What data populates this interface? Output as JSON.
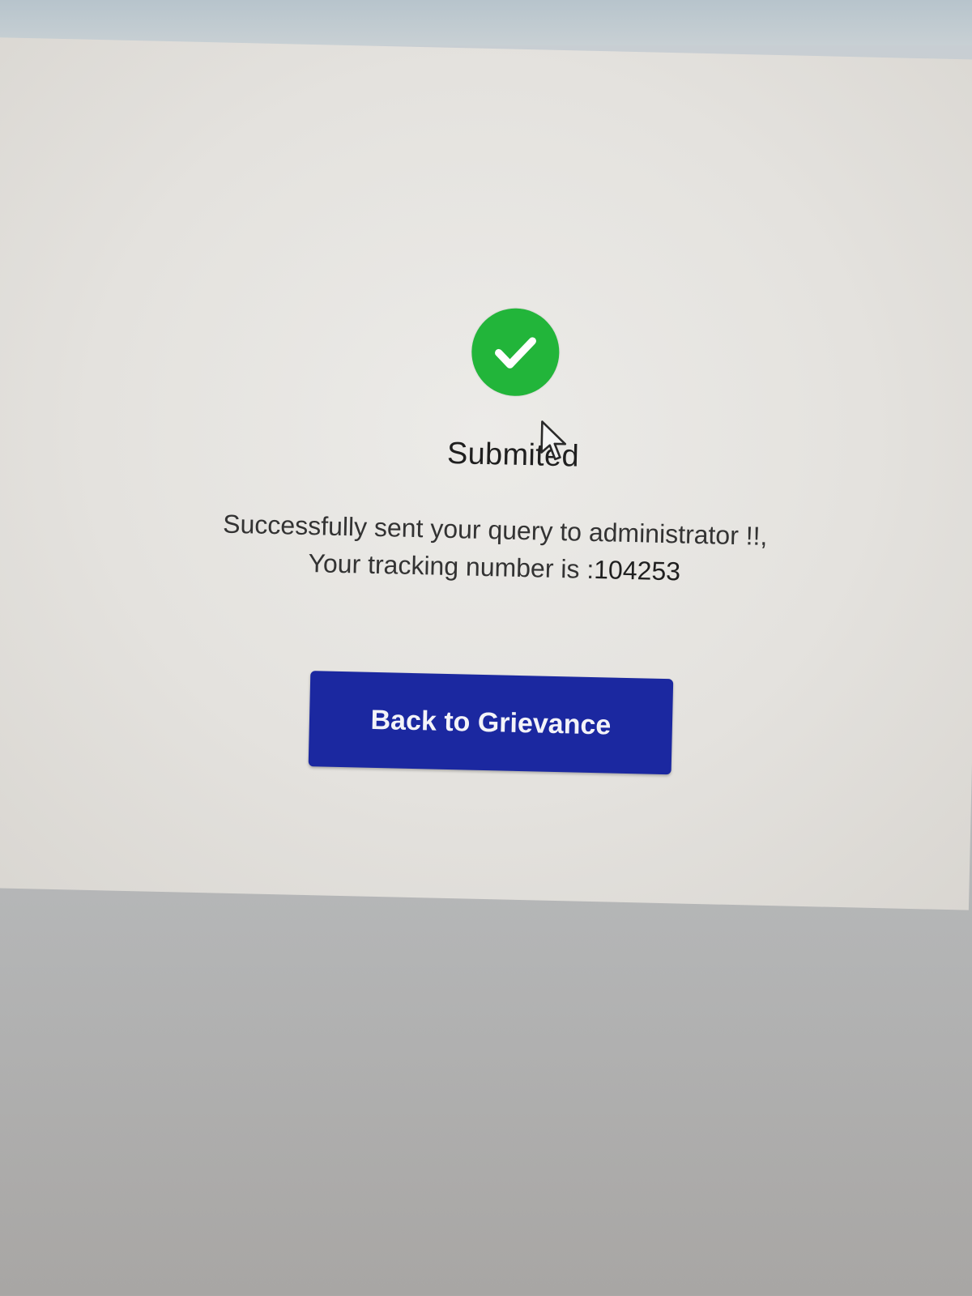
{
  "status": {
    "icon": "check-circle-icon",
    "icon_color": "#22b53a",
    "title": "Submited"
  },
  "message": {
    "line1": "Successfully sent your query to administrator !!,",
    "tracking_label": "Your tracking number is :",
    "tracking_number": "104253"
  },
  "actions": {
    "back_label": "Back to Grievance",
    "button_color": "#1b28a0"
  }
}
